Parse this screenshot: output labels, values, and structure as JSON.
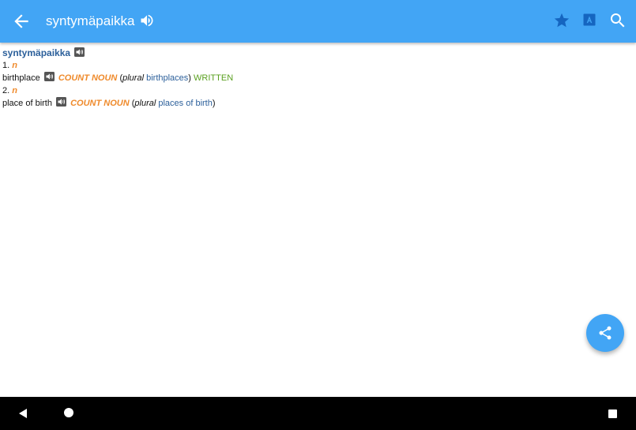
{
  "appbar": {
    "title": "syntymäpaikka",
    "icons": [
      "back-arrow-icon",
      "speaker-icon",
      "star-icon",
      "font-icon",
      "search-icon"
    ],
    "color": "#42a5f5"
  },
  "entry": {
    "headword": "syntymäpaikka",
    "senses": [
      {
        "number": "1.",
        "pos": "n",
        "translation": "birthplace",
        "category": "COUNT NOUN",
        "open_paren": "(",
        "plural_label": "plural",
        "plural_form": "birthplaces",
        "close_paren": ")",
        "register": "WRITTEN"
      },
      {
        "number": "2.",
        "pos": "n",
        "translation": "place of birth",
        "category": "COUNT NOUN",
        "open_paren": "(",
        "plural_label": "plural",
        "plural_form": "places of birth",
        "close_paren": ")"
      }
    ]
  },
  "fab": {
    "icon": "share-icon",
    "color": "#42a5f5"
  },
  "navbar": {
    "icons": [
      "nav-back-icon",
      "nav-home-icon",
      "nav-recents-icon"
    ]
  },
  "colors": {
    "headword": "#2b5f9a",
    "category": "#ef8a2b",
    "register": "#5aa020"
  }
}
